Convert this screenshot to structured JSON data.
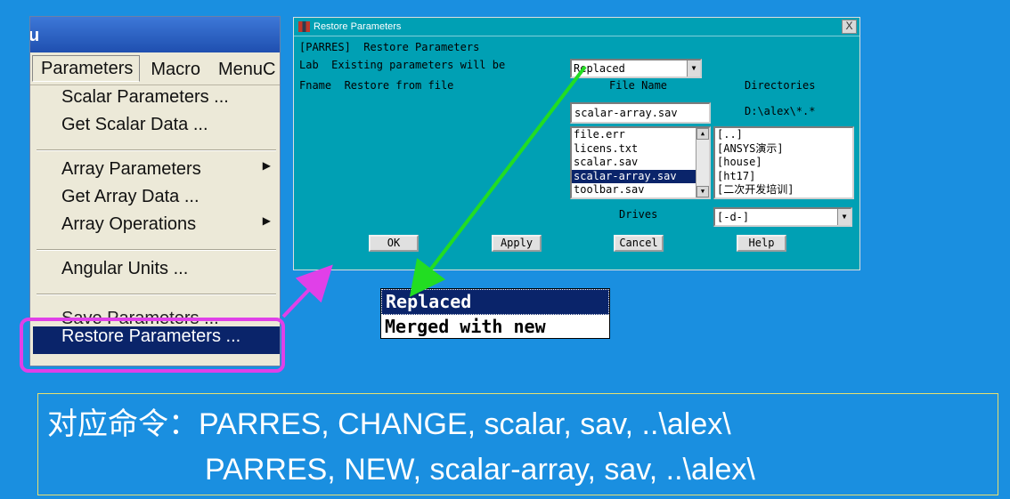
{
  "menu_window": {
    "title_fragment": "u",
    "menubar": [
      "Parameters",
      "Macro",
      "MenuC"
    ],
    "items": [
      {
        "label": "Scalar Parameters ...",
        "submenu": false
      },
      {
        "label": "Get Scalar Data ...",
        "submenu": false
      },
      {
        "label": "Array Parameters",
        "submenu": true
      },
      {
        "label": "Get Array Data ...",
        "submenu": false
      },
      {
        "label": "Array Operations",
        "submenu": true
      },
      {
        "label": "Angular Units ...",
        "submenu": false
      },
      {
        "label": "Save Parameters ...",
        "submenu": false
      },
      {
        "label": "Restore Parameters ...",
        "submenu": false
      }
    ],
    "selected_item": "Restore Parameters ..."
  },
  "dialog": {
    "title": "Restore Parameters",
    "close_label": "X",
    "header": "[PARRES]  Restore Parameters",
    "lab_label": "Lab  Existing parameters will be",
    "lab_value": "Replaced",
    "fname_label": "Fname  Restore from file",
    "file_name_header": "File Name",
    "directories_header": "Directories",
    "file_name_value": "scalar-array.sav",
    "directory_path": "D:\\alex\\*.*",
    "files": [
      "file.err",
      "licens.txt",
      "scalar.sav",
      "scalar-array.sav",
      "toolbar.sav"
    ],
    "selected_file": "scalar-array.sav",
    "directories": [
      "[..]",
      "[ANSYS演示]",
      "[house]",
      "[ht17]",
      "[二次开发培训]"
    ],
    "drives_label": "Drives",
    "drive_value": "[-d-]",
    "buttons": [
      "OK",
      "Apply",
      "Cancel",
      "Help"
    ]
  },
  "popup": {
    "options": [
      "Replaced",
      "Merged with new"
    ],
    "selected": "Replaced"
  },
  "command": {
    "line1": "对应命令：PARRES, CHANGE, scalar, sav, ..\\alex\\",
    "line2": "PARRES, NEW, scalar-array, sav, ..\\alex\\"
  },
  "colors": {
    "background": "#1a8fe0",
    "dialog": "#00a0b4",
    "highlight": "#0a246a",
    "pink_annotation": "#e040e8",
    "green_arrow": "#22dd22"
  }
}
